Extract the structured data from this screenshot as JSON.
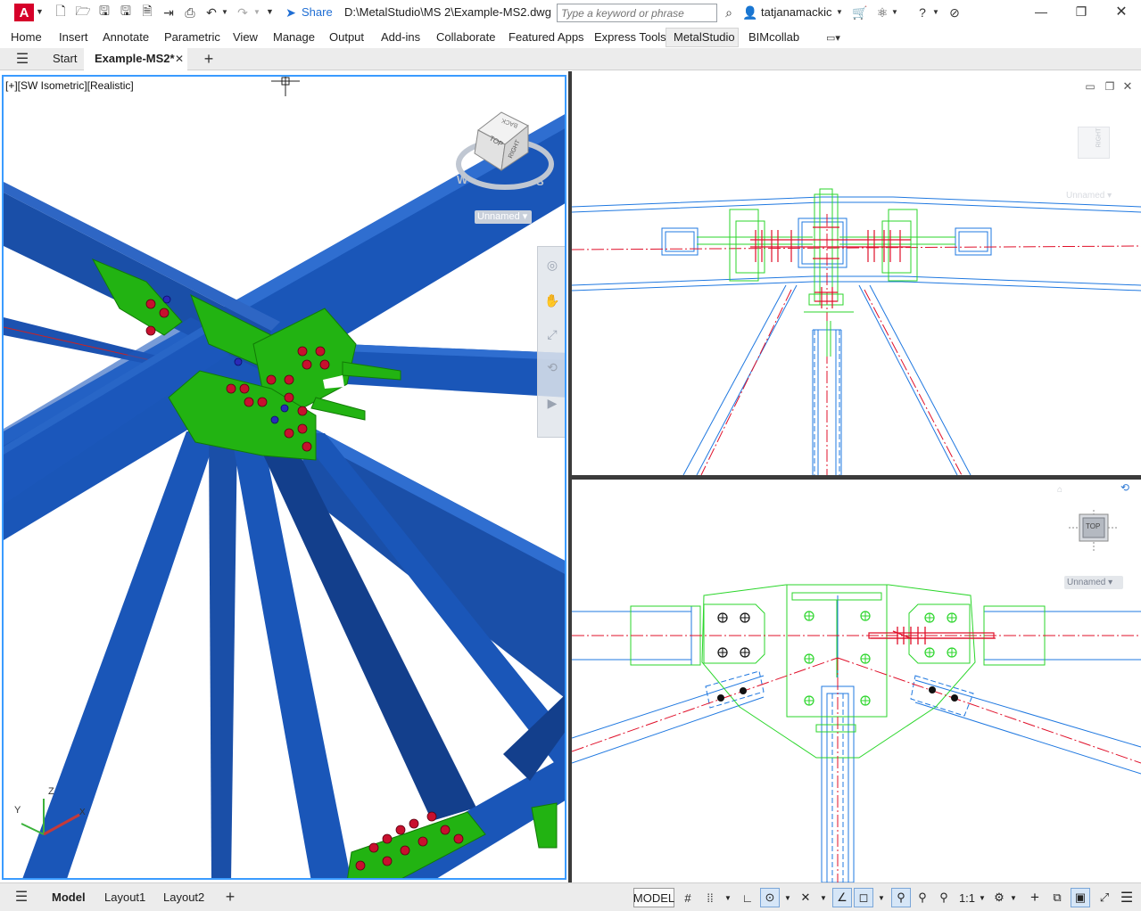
{
  "title_bar": {
    "app_logo": "A",
    "share_label": "Share",
    "file_path": "D:\\MetalStudio\\MS 2\\Example-MS2.dwg",
    "search_placeholder": "Type a keyword or phrase",
    "username": "tatjanamackic"
  },
  "menu": {
    "items": [
      "Home",
      "Insert",
      "Annotate",
      "Parametric",
      "View",
      "Manage",
      "Output",
      "Add-ins",
      "Collaborate",
      "Featured Apps",
      "Express Tools",
      "MetalStudio",
      "BIMcollab"
    ],
    "active": "MetalStudio"
  },
  "tabs": {
    "start": "Start",
    "active": "Example-MS2*"
  },
  "viewport_main": {
    "label": "[+][SW Isometric][Realistic]",
    "viewcube_top": "TOP",
    "viewcube_right": "RIGHT",
    "viewcube_back": "BACK",
    "compass_w": "W",
    "compass_s": "S",
    "named_view": "Unnamed"
  },
  "viewport_top_right": {
    "viewcube_face": "RIGHT",
    "named_view": "Unnamed"
  },
  "viewport_bottom_right": {
    "viewcube_face": "TOP",
    "named_view": "Unnamed"
  },
  "status_bar": {
    "model_tab": "Model",
    "layout1": "Layout1",
    "layout2": "Layout2",
    "model_space": "MODEL",
    "scale": "1:1"
  },
  "colors": {
    "steel_blue": "#1a56b8",
    "plate_green": "#22b312",
    "bolt_red": "#c8102e",
    "cad_blue": "#1f78e0",
    "cad_green": "#2bd62b",
    "centerline_red": "#e0102a",
    "accent_red": "#d6002a"
  }
}
